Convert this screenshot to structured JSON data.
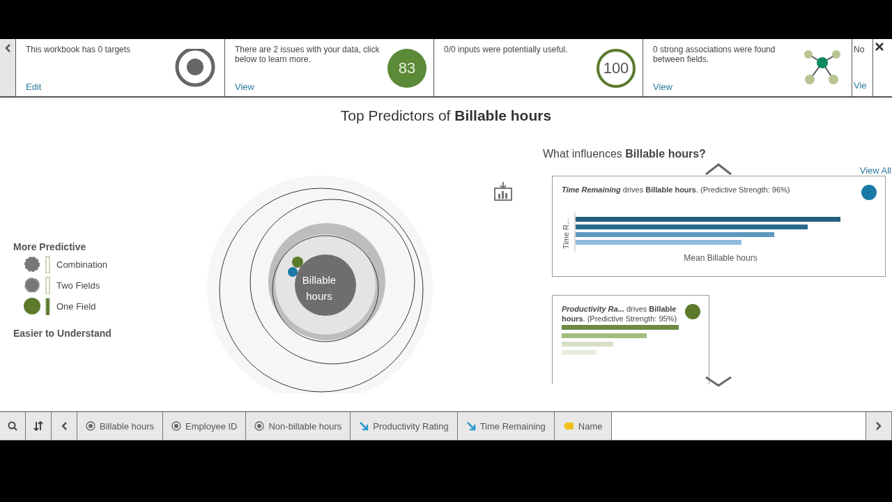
{
  "summary_cards": [
    {
      "text": "This workbook has 0 targets",
      "link": "Edit",
      "kind": "target"
    },
    {
      "text": "There are 2 issues with your data, click below to learn more.",
      "link": "View",
      "kind": "score",
      "score": "83"
    },
    {
      "text": "0/0 inputs were potentially useful.",
      "kind": "ring",
      "score": "100"
    },
    {
      "text": "0 strong associations were found between fields.",
      "link": "View",
      "kind": "network"
    },
    {
      "text": "No",
      "link": "Vie",
      "kind": "partial"
    }
  ],
  "title": {
    "prefix": "Top Predictors of",
    "target": "Billable hours"
  },
  "legend": {
    "top": "More Predictive",
    "bottom": "Easier to Understand",
    "items": [
      {
        "label": "Combination",
        "kind": "combination"
      },
      {
        "label": "Two Fields",
        "kind": "two"
      },
      {
        "label": "One Field",
        "kind": "one"
      }
    ]
  },
  "center_label": "Billable hours",
  "influences": {
    "prefix": "What influences",
    "target": "Billable hours?",
    "view_all": "View All",
    "cards": [
      {
        "text": "**Time Remaining** drives **Billable hours**. (Predictive Strength: 96%)",
        "color": "#1a7aa6",
        "ylabel": "Time R...",
        "xlabel": "Mean Billable hours",
        "kind": "full"
      },
      {
        "text": "**Productivity Ra...** drives **Billable hours**. (Predictive Strength: 95%)",
        "color": "#5b7a2c",
        "kind": "compact"
      }
    ]
  },
  "fields": [
    {
      "label": "Billable hours",
      "kind": "measure"
    },
    {
      "label": "Employee ID",
      "kind": "measure"
    },
    {
      "label": "Non-billable hours",
      "kind": "measure"
    },
    {
      "label": "Productivity Rating",
      "kind": "predictor"
    },
    {
      "label": "Time Remaining",
      "kind": "predictor"
    },
    {
      "label": "Name",
      "kind": "tag"
    }
  ]
}
